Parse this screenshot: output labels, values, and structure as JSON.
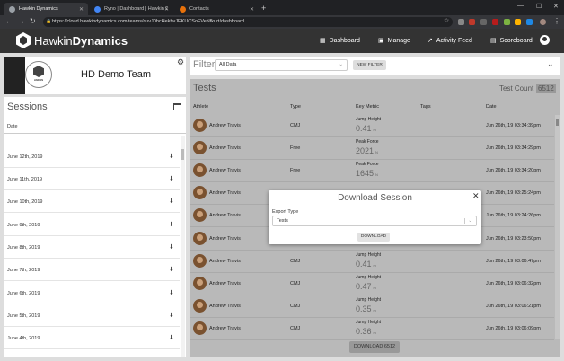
{
  "browser": {
    "tabs": [
      {
        "label": "Hawkin Dynamics",
        "color": "#9aa0a6"
      },
      {
        "label": "Ryno | Dashboard | Hawkin Dyn...",
        "color": "#4285f4"
      },
      {
        "label": "Contacts",
        "color": "#e8710a"
      }
    ],
    "url": "https://cloud.hawkindynamics.com/teams/cuvJ0hcHekbvJEKUCSoFVeNfkurt/dashboard"
  },
  "header": {
    "brand_light": "Hawkin",
    "brand_bold": "Dynamics",
    "nav": [
      {
        "label": "Dashboard",
        "icon": "dashboard-icon"
      },
      {
        "label": "Manage",
        "icon": "id-card-icon"
      },
      {
        "label": "Activity Feed",
        "icon": "trend-icon"
      },
      {
        "label": "Scoreboard",
        "icon": "scoreboard-icon"
      }
    ]
  },
  "team": {
    "name": "HD Demo Team",
    "logo_text": "HAWKIN"
  },
  "sessions": {
    "title": "Sessions",
    "column_header": "Date",
    "items": [
      "June 12th, 2019",
      "June 11th, 2019",
      "June 10th, 2019",
      "June 9th, 2019",
      "June 8th, 2019",
      "June 7th, 2019",
      "June 6th, 2019",
      "June 5th, 2019",
      "June 4th, 2019"
    ]
  },
  "filter": {
    "label": "Filter",
    "selected": "All Data",
    "new_filter_label": "NEW FILTER"
  },
  "tests": {
    "title": "Tests",
    "count_label": "Test Count",
    "count_value": "6512",
    "columns": [
      "Athlete",
      "Type",
      "Key Metric",
      "Tags",
      "Date"
    ],
    "rows": [
      {
        "athlete": "Andrew Travis",
        "type": "CMJ",
        "metric_label": "Jump Height",
        "metric_value": "0.41",
        "unit": "m",
        "date": "Jun 26th, 19 03:34:39pm"
      },
      {
        "athlete": "Andrew Travis",
        "type": "Free",
        "metric_label": "Peak Force",
        "metric_value": "2021",
        "unit": "N",
        "date": "Jun 26th, 19 03:34:29pm"
      },
      {
        "athlete": "Andrew Travis",
        "type": "Free",
        "metric_label": "Peak Force",
        "metric_value": "1645",
        "unit": "N",
        "date": "Jun 26th, 19 03:34:20pm"
      },
      {
        "athlete": "Andrew Travis",
        "type": "",
        "metric_label": "",
        "metric_value": "",
        "unit": "",
        "date": "Jun 26th, 19 03:25:24pm"
      },
      {
        "athlete": "Andrew Travis",
        "type": "",
        "metric_label": "",
        "metric_value": "",
        "unit": "",
        "date": "Jun 26th, 19 03:24:26pm"
      },
      {
        "athlete": "Andrew Travis",
        "type": "",
        "metric_label": "",
        "metric_value": "",
        "unit": "",
        "date": "Jun 26th, 19 03:23:50pm"
      },
      {
        "athlete": "Andrew Travis",
        "type": "CMJ",
        "metric_label": "Jump Height",
        "metric_value": "0.41",
        "unit": "m",
        "date": "Jun 26th, 19 03:06:47pm"
      },
      {
        "athlete": "Andrew Travis",
        "type": "CMJ",
        "metric_label": "Jump Height",
        "metric_value": "0.47",
        "unit": "m",
        "date": "Jun 26th, 19 03:06:32pm"
      },
      {
        "athlete": "Andrew Travis",
        "type": "CMJ",
        "metric_label": "Jump Height",
        "metric_value": "0.35",
        "unit": "m",
        "date": "Jun 26th, 19 03:06:21pm"
      },
      {
        "athlete": "Andrew Travis",
        "type": "CMJ",
        "metric_label": "Jump Height",
        "metric_value": "0.36",
        "unit": "m",
        "date": "Jun 26th, 19 03:06:09pm"
      }
    ],
    "download_label": "DOWNLOAD",
    "download_count": "6512"
  },
  "modal": {
    "title": "Download Session",
    "field_label": "Export Type",
    "selected": "Tests",
    "button_label": "DOWNLOAD"
  }
}
